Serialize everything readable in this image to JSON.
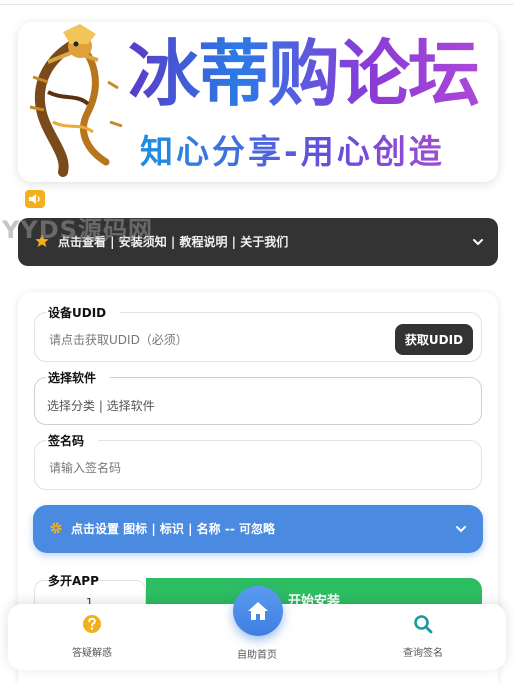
{
  "banner": {
    "title": "冰蒂购论坛",
    "subtitle": "知心分享-用心创造"
  },
  "watermark": "YYDS源码网",
  "notice_bar": {
    "text": "点击查看 | 安装须知 | 教程说明 | 关于我们",
    "icon": "star-icon"
  },
  "form": {
    "udid": {
      "label": "设备UDID",
      "placeholder": "请点击获取UDID（必须）",
      "button": "获取UDID"
    },
    "software": {
      "label": "选择软件",
      "value": "选择分类 | 选择软件"
    },
    "sign_code": {
      "label": "签名码",
      "placeholder": "请输入签名码"
    },
    "settings_bar": {
      "text": "点击设置 图标 | 标识 | 名称 -- 可忽略",
      "icon": "gear-icon"
    },
    "multi_app": {
      "label": "多开APP",
      "value": "1"
    },
    "install_button": "开始安装"
  },
  "bottom_nav": {
    "items": [
      {
        "label": "答疑解惑",
        "icon": "question-icon"
      },
      {
        "label": "自助首页",
        "icon": "home-icon"
      },
      {
        "label": "查询签名",
        "icon": "search-icon"
      }
    ]
  },
  "colors": {
    "dark_bar": "#333333",
    "blue_bar": "#4a8ae0",
    "install_green": "#2dbd62",
    "accent_yellow": "#f2b01e",
    "teal_icon": "#1a9aa0"
  }
}
